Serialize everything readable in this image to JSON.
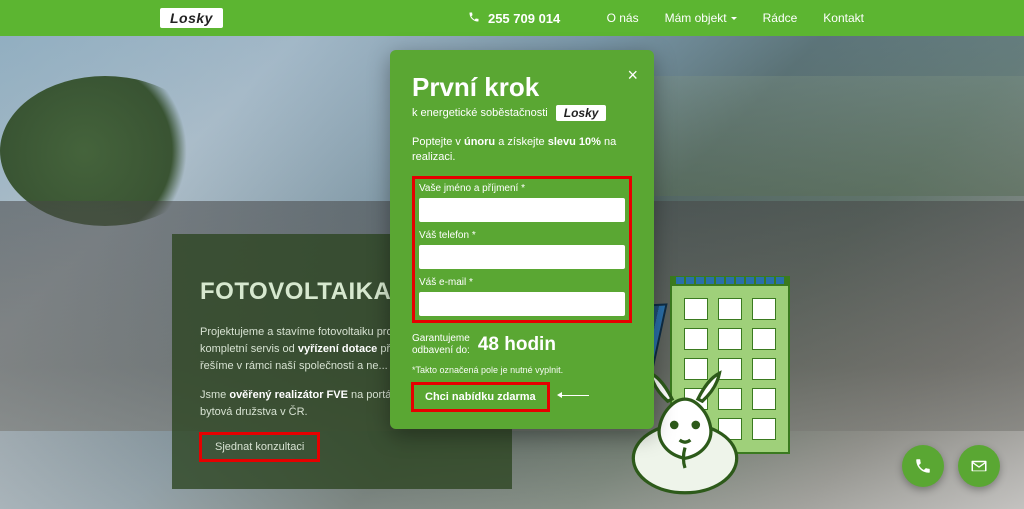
{
  "brand": "Losky",
  "phone": "255 709 014",
  "nav": [
    "O nás",
    "Mám objekt",
    "Rádce",
    "Kontakt"
  ],
  "hero": {
    "title": "FOTOVOLTAIKA BY",
    "p1_a": "Projektujeme a stavíme fotovoltaiku pro by... ",
    "p1_b": "kompletní servis od ",
    "p1_bold": "vyřízení dotace",
    "p1_c": " přes ... proces řešíme v rámci naší společnosti a ne...",
    "p2_a": "Jsme ",
    "p2_bold": "ověřený realizátor FVE",
    "p2_b": " na portálu fo... největší bytová družstva v ČR.",
    "cta": "Sjednat konzultaci"
  },
  "modal": {
    "title": "První krok",
    "subtitle": "k energetické soběstačnosti",
    "promo_a": "Poptejte v ",
    "promo_b": "únoru",
    "promo_c": " a získejte ",
    "promo_d": "slevu 10%",
    "promo_e": " na realizaci.",
    "labels": {
      "name": "Vaše jméno a příjmení *",
      "phone": "Váš telefon *",
      "email": "Váš e-mail *"
    },
    "guarantee_left_1": "Garantujeme",
    "guarantee_left_2": "odbavení do:",
    "guarantee_value": "48 hodin",
    "required": "*Takto označená pole je nutné vyplnit.",
    "submit": "Chci nabídku zdarma"
  }
}
